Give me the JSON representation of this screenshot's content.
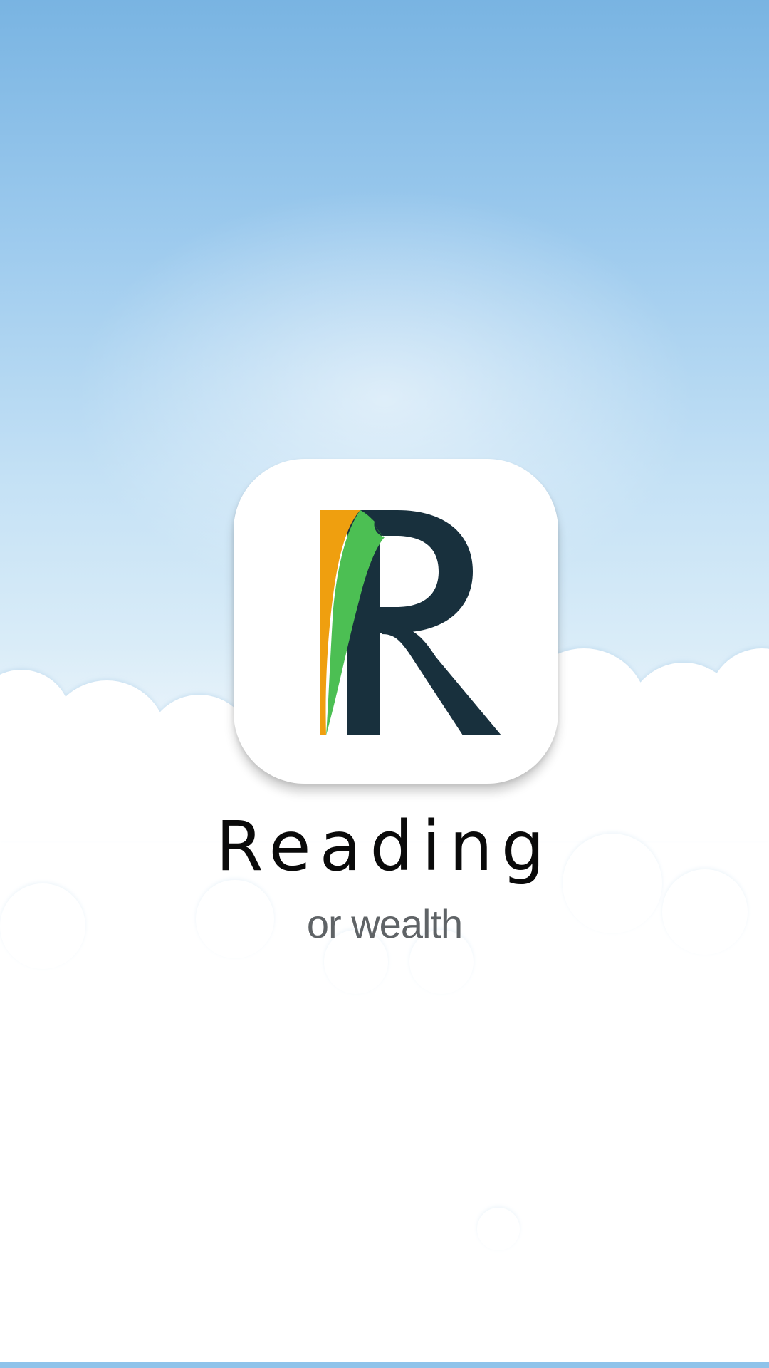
{
  "splash": {
    "app_name": "Reading",
    "slogan": "or wealth",
    "logo": {
      "icon": "letter-r-page-curl-logo",
      "colors": {
        "letter": "#18303d",
        "page_green": "#4cbf53",
        "page_orange": "#ef9f0f",
        "tile": "#ffffff"
      }
    }
  },
  "theme": {
    "sky_top": "#79b4e2",
    "sky_mid": "#c4e1f5",
    "cloud": "#ffffff",
    "bottom_bar": "#8fc3ea"
  }
}
